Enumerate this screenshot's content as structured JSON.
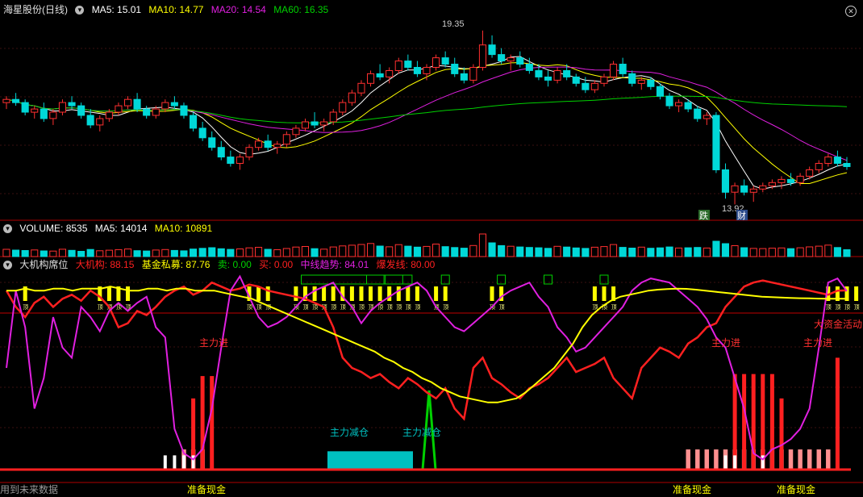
{
  "colors": {
    "red": "#ff2020",
    "magenta": "#e020e0",
    "yellow": "#ffff00",
    "green": "#00d000",
    "cyan": "#00c0c0",
    "pink": "#ff9090",
    "white": "#ffffff",
    "label_red": "#ff3030"
  },
  "header_price": {
    "title": "海星股份(日线)",
    "ma5": "MA5: 15.01",
    "ma10": "MA10: 14.77",
    "ma20": "MA20: 14.54",
    "ma60": "MA60: 16.35",
    "icon": "chevron-down-icon"
  },
  "header_volume": {
    "volume": "VOLUME: 8535",
    "ma5": "MA5: 14014",
    "ma10": "MA10: 10891"
  },
  "header_indicator": {
    "title": "大机构席位",
    "big_inst": "大机构: 88.15",
    "fund": "基金私募: 87.76",
    "buy": "卖: 0.00",
    "sell": "买: 0.00",
    "mid_trend": "中线趋势: 84.01",
    "burst": "爆发线: 80.00"
  },
  "annotations": {
    "high": "19.35",
    "low": "13.92",
    "tag_fall": "跌",
    "tag_finance": "财",
    "main_in_1": "主力进",
    "main_in_2": "主力进",
    "main_in_3": "主力进",
    "reduce_1": "主力减仓",
    "reduce_2": "主力减仓",
    "big_fund": "大资金活动",
    "cash_1": "准备现金",
    "cash_2": "准备现金",
    "cash_3": "准备现金",
    "bar_glyph": "顶"
  },
  "footer": "用到未来数据",
  "chart_data": [
    {
      "type": "candlestick",
      "title": "海星股份(日线)",
      "notes": "approximate daily OHLC read from the chart; 'up' candles drawn red hollow, 'down' candles cyan filled",
      "candles": [
        [
          17.1,
          17.3,
          16.9,
          17.2
        ],
        [
          17.2,
          17.4,
          17.0,
          17.1
        ],
        [
          17.1,
          17.2,
          16.7,
          16.8
        ],
        [
          16.8,
          17.0,
          16.6,
          16.9
        ],
        [
          16.9,
          17.1,
          16.5,
          16.6
        ],
        [
          16.6,
          16.9,
          16.4,
          16.8
        ],
        [
          16.8,
          17.2,
          16.7,
          17.1
        ],
        [
          17.1,
          17.3,
          16.9,
          17.0
        ],
        [
          17.0,
          17.1,
          16.6,
          16.7
        ],
        [
          16.7,
          16.9,
          16.3,
          16.4
        ],
        [
          16.4,
          16.7,
          16.2,
          16.6
        ],
        [
          16.6,
          16.9,
          16.5,
          16.8
        ],
        [
          16.8,
          17.1,
          16.7,
          17.0
        ],
        [
          17.0,
          17.3,
          16.9,
          17.2
        ],
        [
          17.2,
          17.4,
          16.8,
          16.9
        ],
        [
          16.9,
          17.0,
          16.6,
          16.7
        ],
        [
          16.7,
          17.0,
          16.6,
          16.9
        ],
        [
          16.9,
          17.2,
          16.8,
          17.1
        ],
        [
          17.1,
          17.3,
          16.9,
          17.0
        ],
        [
          17.0,
          17.1,
          16.6,
          16.7
        ],
        [
          16.7,
          16.8,
          16.2,
          16.3
        ],
        [
          16.3,
          16.5,
          15.9,
          16.0
        ],
        [
          16.0,
          16.2,
          15.6,
          15.7
        ],
        [
          15.7,
          15.9,
          15.3,
          15.4
        ],
        [
          15.4,
          15.6,
          15.1,
          15.2
        ],
        [
          15.2,
          15.5,
          15.0,
          15.4
        ],
        [
          15.4,
          15.8,
          15.3,
          15.7
        ],
        [
          15.7,
          16.0,
          15.6,
          15.9
        ],
        [
          15.9,
          16.1,
          15.6,
          15.7
        ],
        [
          15.7,
          15.9,
          15.5,
          15.8
        ],
        [
          15.8,
          16.2,
          15.7,
          16.1
        ],
        [
          16.1,
          16.4,
          16.0,
          16.3
        ],
        [
          16.3,
          16.6,
          16.2,
          16.5
        ],
        [
          16.5,
          16.8,
          16.3,
          16.4
        ],
        [
          16.4,
          16.6,
          16.2,
          16.5
        ],
        [
          16.5,
          16.9,
          16.4,
          16.8
        ],
        [
          16.8,
          17.2,
          16.7,
          17.1
        ],
        [
          17.1,
          17.5,
          17.0,
          17.4
        ],
        [
          17.4,
          17.8,
          17.3,
          17.7
        ],
        [
          17.7,
          18.1,
          17.6,
          18.0
        ],
        [
          18.0,
          18.3,
          17.8,
          17.9
        ],
        [
          17.9,
          18.2,
          17.7,
          18.1
        ],
        [
          18.1,
          18.5,
          18.0,
          18.4
        ],
        [
          18.4,
          18.6,
          18.1,
          18.2
        ],
        [
          18.2,
          18.4,
          17.9,
          18.0
        ],
        [
          18.0,
          18.3,
          17.8,
          18.2
        ],
        [
          18.2,
          18.6,
          18.1,
          18.5
        ],
        [
          18.5,
          18.7,
          18.2,
          18.3
        ],
        [
          18.3,
          18.5,
          17.9,
          18.0
        ],
        [
          18.0,
          18.2,
          17.7,
          17.8
        ],
        [
          17.8,
          18.3,
          17.7,
          18.2
        ],
        [
          18.2,
          19.35,
          18.1,
          18.9
        ],
        [
          18.9,
          19.2,
          18.5,
          18.6
        ],
        [
          18.6,
          18.8,
          18.3,
          18.4
        ],
        [
          18.4,
          18.6,
          18.1,
          18.5
        ],
        [
          18.5,
          18.7,
          18.2,
          18.3
        ],
        [
          18.3,
          18.5,
          18.0,
          18.1
        ],
        [
          18.1,
          18.3,
          17.8,
          17.9
        ],
        [
          17.9,
          18.1,
          17.6,
          17.8
        ],
        [
          17.8,
          18.2,
          17.7,
          18.1
        ],
        [
          18.1,
          18.3,
          17.8,
          17.9
        ],
        [
          17.9,
          18.0,
          17.6,
          17.7
        ],
        [
          17.7,
          17.9,
          17.4,
          17.5
        ],
        [
          17.5,
          17.8,
          17.4,
          17.7
        ],
        [
          17.7,
          18.0,
          17.6,
          17.9
        ],
        [
          17.9,
          18.4,
          17.8,
          18.3
        ],
        [
          18.3,
          18.5,
          17.9,
          18.0
        ],
        [
          18.0,
          18.1,
          17.6,
          17.7
        ],
        [
          17.7,
          17.9,
          17.5,
          17.8
        ],
        [
          17.8,
          17.9,
          17.5,
          17.6
        ],
        [
          17.6,
          17.7,
          17.2,
          17.3
        ],
        [
          17.3,
          17.4,
          16.9,
          17.0
        ],
        [
          17.0,
          17.2,
          16.8,
          17.1
        ],
        [
          17.1,
          17.2,
          16.8,
          16.9
        ],
        [
          16.9,
          17.0,
          16.5,
          16.6
        ],
        [
          16.6,
          16.8,
          16.4,
          16.7
        ],
        [
          16.7,
          16.8,
          14.9,
          15.0
        ],
        [
          15.0,
          15.2,
          14.1,
          14.3
        ],
        [
          14.3,
          14.6,
          13.92,
          14.5
        ],
        [
          14.5,
          14.7,
          14.2,
          14.3
        ],
        [
          14.3,
          14.5,
          14.0,
          14.4
        ],
        [
          14.4,
          14.6,
          14.3,
          14.5
        ],
        [
          14.5,
          14.7,
          14.4,
          14.6
        ],
        [
          14.6,
          14.8,
          14.4,
          14.7
        ],
        [
          14.7,
          14.9,
          14.5,
          14.6
        ],
        [
          14.6,
          14.9,
          14.5,
          14.8
        ],
        [
          14.8,
          15.1,
          14.7,
          15.0
        ],
        [
          15.0,
          15.3,
          14.9,
          15.2
        ],
        [
          15.2,
          15.5,
          15.1,
          15.4
        ],
        [
          15.4,
          15.6,
          15.1,
          15.2
        ],
        [
          15.2,
          15.4,
          15.0,
          15.1
        ]
      ],
      "ma_lines": [
        "MA5",
        "MA10",
        "MA20",
        "MA60"
      ],
      "yrange": [
        13.5,
        19.8
      ]
    },
    {
      "type": "bar",
      "title": "VOLUME",
      "series": [
        {
          "name": "VOLUME",
          "values": [
            9000,
            8000,
            7500,
            8200,
            7000,
            6800,
            9100,
            7700,
            6500,
            8800,
            7200,
            7900,
            8600,
            9400,
            7300,
            6900,
            8100,
            8700,
            7600,
            7100,
            9300,
            10200,
            11000,
            9700,
            8900,
            9500,
            10800,
            11500,
            9000,
            8500,
            10000,
            11800,
            12500,
            9800,
            9200,
            11900,
            13200,
            14100,
            15000,
            16200,
            13000,
            12100,
            14800,
            12900,
            11700,
            12600,
            15500,
            12300,
            11200,
            10400,
            13700,
            28000,
            17000,
            13600,
            12800,
            11900,
            11300,
            10900,
            10200,
            12700,
            11800,
            10700,
            10100,
            11600,
            12400,
            14900,
            11400,
            10500,
            11700,
            10300,
            10800,
            11900,
            10600,
            10900,
            11300,
            10600,
            19000,
            16000,
            13500,
            11000,
            10100,
            9900,
            10400,
            10700,
            9800,
            10900,
            12000,
            12900,
            14200,
            11200,
            8535
          ]
        }
      ]
    },
    {
      "type": "line",
      "title": "大机构席位",
      "series": [
        {
          "name": "大机构",
          "values": [
            88,
            80,
            75,
            82,
            85,
            80,
            84,
            86,
            83,
            88,
            85,
            80,
            70,
            72,
            78,
            76,
            80,
            85,
            88,
            90,
            86,
            88,
            92,
            90,
            88,
            89,
            91,
            90,
            88,
            87,
            86,
            85,
            84,
            82,
            80,
            70,
            55,
            50,
            48,
            45,
            47,
            43,
            40,
            45,
            42,
            38,
            35,
            40,
            30,
            25,
            50,
            55,
            45,
            42,
            38,
            35,
            40,
            42,
            45,
            50,
            55,
            48,
            50,
            52,
            55,
            45,
            40,
            35,
            50,
            55,
            60,
            58,
            55,
            62,
            65,
            70,
            72,
            80,
            85,
            90,
            92,
            93,
            92,
            91,
            90,
            89,
            88,
            87,
            86,
            88,
            88.15
          ]
        },
        {
          "name": "基金私募",
          "values": [
            50,
            88,
            70,
            30,
            45,
            75,
            60,
            55,
            80,
            75,
            68,
            78,
            82,
            78,
            82,
            85,
            70,
            65,
            20,
            8,
            5,
            10,
            30,
            60,
            88,
            95,
            85,
            75,
            70,
            72,
            75,
            80,
            85,
            88,
            90,
            92,
            85,
            80,
            72,
            78,
            82,
            85,
            88,
            90,
            92,
            88,
            80,
            75,
            70,
            68,
            72,
            76,
            80,
            85,
            88,
            90,
            92,
            85,
            80,
            70,
            65,
            58,
            60,
            65,
            70,
            75,
            80,
            88,
            92,
            94,
            93,
            92,
            88,
            84,
            80,
            74,
            65,
            60,
            45,
            30,
            8,
            5,
            10,
            12,
            15,
            20,
            30,
            60,
            92,
            94,
            87.76
          ]
        },
        {
          "name": "中线趋势",
          "values": [
            88,
            88,
            89,
            88,
            88,
            89,
            89,
            88,
            89,
            89,
            89,
            90,
            89,
            88,
            88,
            89,
            89,
            88,
            89,
            89,
            88,
            88,
            88,
            87,
            86,
            85,
            84,
            82,
            80,
            78,
            76,
            74,
            72,
            70,
            68,
            66,
            64,
            62,
            60,
            58,
            55,
            53,
            50,
            48,
            45,
            43,
            40,
            38,
            36,
            35,
            34,
            33,
            33,
            34,
            35,
            38,
            42,
            46,
            50,
            56,
            62,
            70,
            76,
            80,
            83,
            85,
            86,
            87,
            88,
            88.5,
            88.8,
            89,
            88.9,
            88.5,
            88,
            87.5,
            87,
            86.5,
            86,
            85.5,
            85,
            84.8,
            84.6,
            84.4,
            84.3,
            84.2,
            84.1,
            84.05,
            84.02,
            84.01
          ]
        },
        {
          "name": "爆发线",
          "values": [
            80
          ]
        }
      ],
      "yrange": [
        0,
        100
      ]
    }
  ]
}
